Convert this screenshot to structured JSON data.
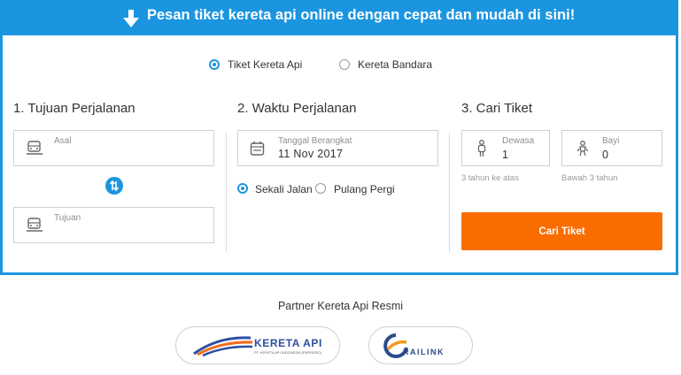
{
  "banner": {
    "text": "Pesan tiket kereta api online dengan cepat dan mudah di sini!"
  },
  "ticket_type": {
    "options": [
      {
        "label": "Tiket Kereta Api",
        "selected": true
      },
      {
        "label": "Kereta Bandara",
        "selected": false
      }
    ]
  },
  "sections": {
    "tujuan": {
      "title": "1. Tujuan Perjalanan"
    },
    "waktu": {
      "title": "2. Waktu Perjalanan"
    },
    "cari": {
      "title": "3. Cari Tiket"
    }
  },
  "origin": {
    "label": "Asal",
    "value": ""
  },
  "destination": {
    "label": "Tujuan",
    "value": ""
  },
  "departure": {
    "label": "Tanggal Berangkat",
    "value": "11 Nov 2017"
  },
  "trip_type": {
    "options": [
      {
        "label": "Sekali Jalan",
        "selected": true
      },
      {
        "label": "Pulang Pergi",
        "selected": false
      }
    ]
  },
  "passengers": {
    "adult": {
      "label": "Dewasa",
      "value": "1",
      "hint": "3 tahun ke atas"
    },
    "infant": {
      "label": "Bayi",
      "value": "0",
      "hint": "Bawah 3 tahun"
    }
  },
  "search_button": {
    "label": "Cari Tiket"
  },
  "partners": {
    "title": "Partner Kereta Api Resmi",
    "kai": {
      "name": "KERETA API",
      "subtitle": "PT. KERETA API INDONESIA (PERSERO)"
    },
    "railink": {
      "name": "RAILINK"
    }
  },
  "colors": {
    "primary": "#1b95e0",
    "accent": "#f96d00",
    "border": "#cfcfcf"
  }
}
